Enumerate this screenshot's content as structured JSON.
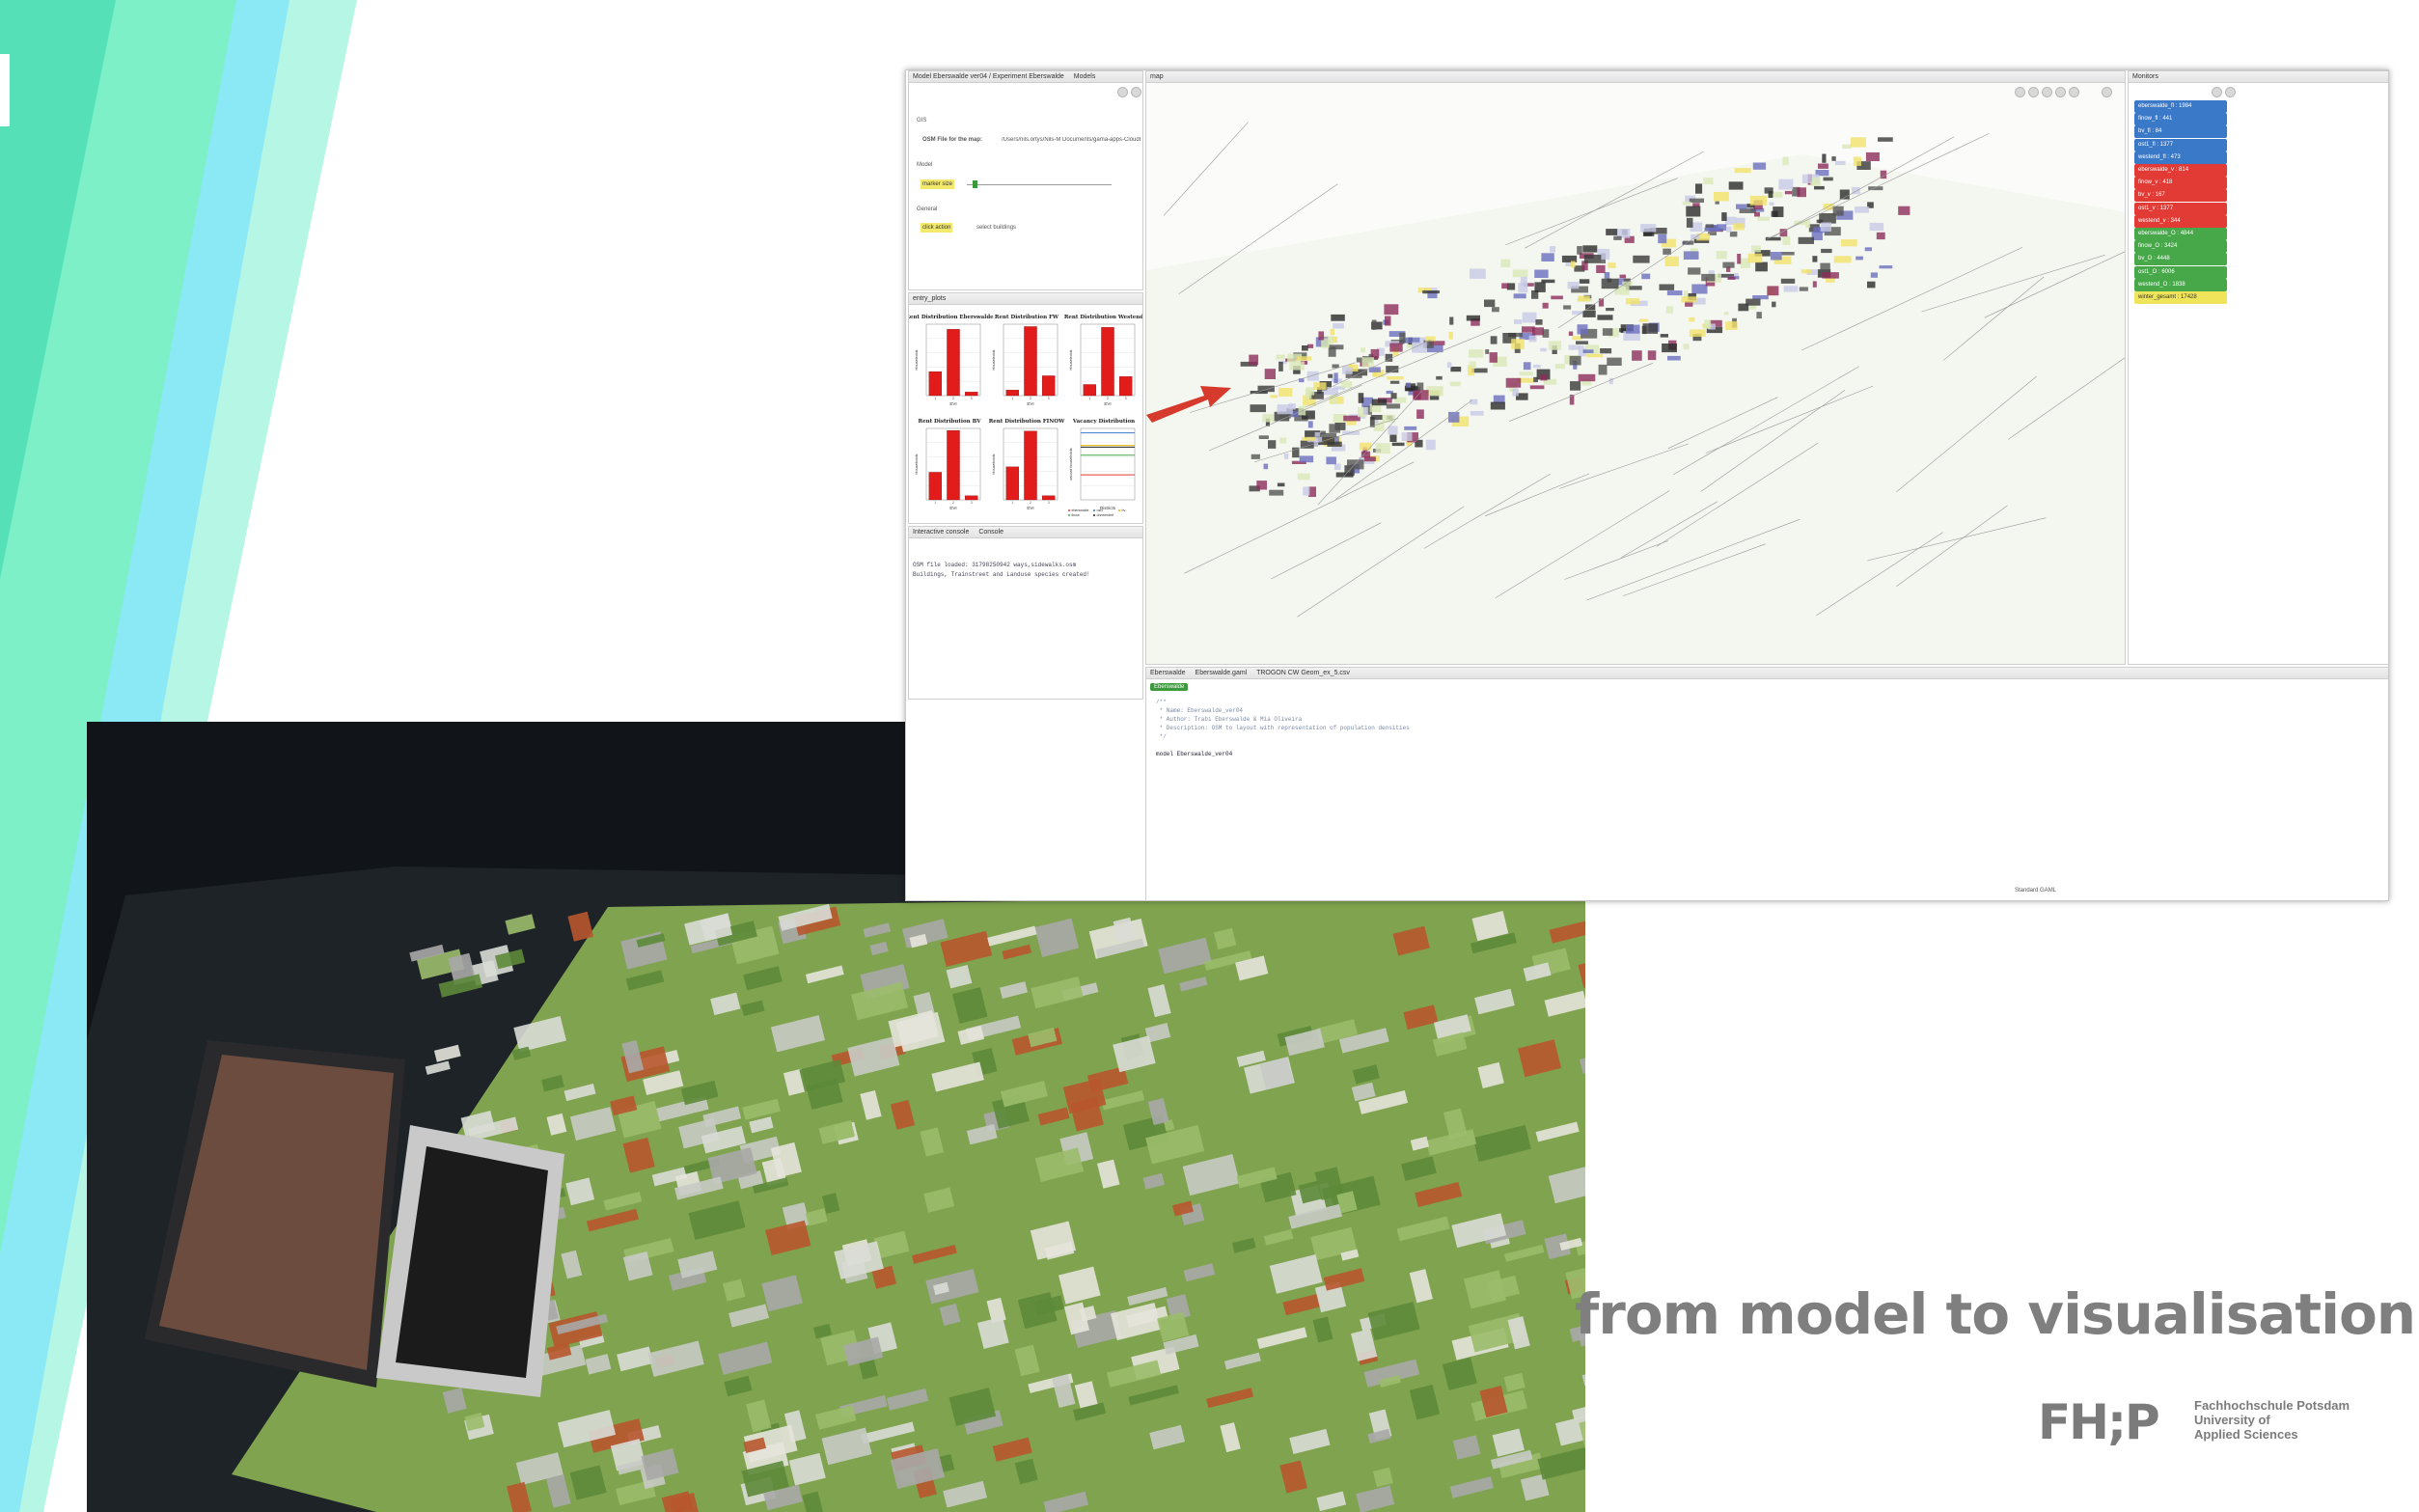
{
  "slide": {
    "headline": "from model to visualisation",
    "logo": {
      "mark": "FH;P",
      "lines": [
        "Fachhochschule Potsdam",
        "University of",
        "Applied Sciences"
      ]
    },
    "accent_colors": [
      "#7df0c8",
      "#8be8f5",
      "#28c9e8"
    ]
  },
  "gama": {
    "model_tabs": [
      "Model Eberswalde ver04 / Experiment Eberswalde",
      "Models"
    ],
    "map_tab": "map",
    "monitors_tab": "Monitors",
    "params": {
      "group_gis": "GIS",
      "osm_label": "OSM File for the map:",
      "osm_value": "/Users/nils.ortys/Nils-M Documents/gama-apps-CloudBaseline/osm/data.osm",
      "group_model": "Model",
      "marker_label": "marker size",
      "group_general": "General",
      "click_label": "click action",
      "click_value": "select buildings"
    },
    "charts_tab": "entry_plots",
    "console_tabs": [
      "Interactive console",
      "Console"
    ],
    "console_lines": [
      "OSM file loaded: 31798250942 ways,sidewalks.osm",
      "Buildings, Trainstreet and Landuse species created!"
    ],
    "editor_tabs": [
      "Eberswalde",
      "Eberswalde.gaml",
      "TROGON CW Geom_ex_5.csv"
    ],
    "editor_badge": "Eberswalde",
    "editor_lines": [
      "/**",
      " * Name: Eberswalde_ver04",
      " * Author: Trabi Eberswalde & Mia Oliveira",
      " * Description: OSM to layout with representation of population densities",
      " */",
      "",
      "model Eberswalde_ver04"
    ],
    "status": "Standard GAML"
  },
  "monitors": [
    {
      "label": "eberswalde_fl",
      "value": "1984",
      "color": "#3a78c8"
    },
    {
      "label": "finow_fl",
      "value": "441",
      "color": "#3a78c8"
    },
    {
      "label": "bv_fl",
      "value": "84",
      "color": "#3a78c8"
    },
    {
      "label": "ost1_fl",
      "value": "1377",
      "color": "#3a78c8"
    },
    {
      "label": "westend_fl",
      "value": "473",
      "color": "#3a78c8"
    },
    {
      "label": "eberswalde_v",
      "value": "814",
      "color": "#e23b35"
    },
    {
      "label": "finow_v",
      "value": "418",
      "color": "#e23b35"
    },
    {
      "label": "bv_v",
      "value": "167",
      "color": "#e23b35"
    },
    {
      "label": "ost1_v",
      "value": "1377",
      "color": "#e23b35"
    },
    {
      "label": "westend_v",
      "value": "344",
      "color": "#e23b35"
    },
    {
      "label": "eberswalde_O",
      "value": "4844",
      "color": "#47a84a"
    },
    {
      "label": "finow_O",
      "value": "3424",
      "color": "#47a84a"
    },
    {
      "label": "bv_O",
      "value": "4448",
      "color": "#47a84a"
    },
    {
      "label": "ost1_O",
      "value": "6006",
      "color": "#47a84a"
    },
    {
      "label": "westend_O",
      "value": "1838",
      "color": "#47a84a"
    },
    {
      "label": "winter_gesamt",
      "value": "17428",
      "color": "#f0e55a"
    }
  ],
  "chart_data": [
    {
      "type": "bar",
      "title": "Rent Distribution Eberswalde",
      "categories": [
        "1",
        "2",
        "3"
      ],
      "values": [
        470,
        1300,
        70
      ],
      "xlabel": "EVI",
      "ylabel": "Households",
      "ylim": [
        0,
        1400
      ]
    },
    {
      "type": "bar",
      "title": "Rent Distribution FW",
      "categories": [
        "1",
        "2",
        "3"
      ],
      "values": [
        70,
        870,
        250
      ],
      "xlabel": "EVI",
      "ylabel": "Households",
      "ylim": [
        0,
        900
      ]
    },
    {
      "type": "bar",
      "title": "Rent Distribution Westend",
      "categories": [
        "1",
        "2",
        "3"
      ],
      "values": [
        70,
        430,
        120
      ],
      "xlabel": "EVI",
      "ylabel": "Households",
      "ylim": [
        0,
        450
      ]
    },
    {
      "type": "bar",
      "title": "Rent Distribution BV",
      "categories": [
        "1",
        "2",
        "3"
      ],
      "values": [
        27,
        68,
        4
      ],
      "xlabel": "EVI",
      "ylabel": "Households",
      "ylim": [
        0,
        70
      ]
    },
    {
      "type": "bar",
      "title": "Rent Distribution FINOW",
      "categories": [
        "1",
        "2",
        "3"
      ],
      "values": [
        120,
        250,
        15
      ],
      "xlabel": "EVI",
      "ylabel": "Households",
      "ylim": [
        0,
        260
      ]
    },
    {
      "type": "line",
      "title": "Vacancy Distribution",
      "xlabel": "Districts",
      "ylabel": "vacant households",
      "series": [
        {
          "name": "eberswalde",
          "color": "#e23b35",
          "values": [
            560,
            560,
            560,
            560,
            560
          ]
        },
        {
          "name": "ost1",
          "color": "#3a78c8",
          "values": [
            1500,
            1500,
            1500,
            1500,
            1500
          ]
        },
        {
          "name": "bv",
          "color": "#f0b400",
          "values": [
            1220,
            1220,
            1220,
            1220,
            1220
          ]
        },
        {
          "name": "finow",
          "color": "#47a84a",
          "values": [
            1000,
            1000,
            1000,
            1000,
            1000
          ]
        },
        {
          "name": "ohneendert",
          "color": "#222222",
          "values": [
            1180,
            1180,
            1180,
            1180,
            1180
          ]
        }
      ],
      "ylim": [
        0,
        1600
      ]
    }
  ]
}
